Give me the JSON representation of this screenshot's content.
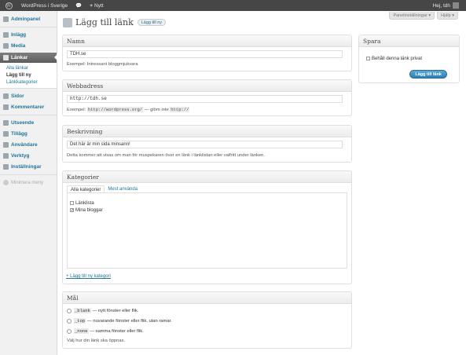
{
  "admin_bar": {
    "site_name": "WordPress i Sverige",
    "comments_count": "",
    "new_label": "Nytt",
    "greeting": "Hej, tdh"
  },
  "sidebar": {
    "items": [
      {
        "label": "Adminpanel",
        "icon": "dashboard-icon"
      },
      {
        "label": "Inlägg",
        "icon": "posts-icon"
      },
      {
        "label": "Media",
        "icon": "media-icon"
      },
      {
        "label": "Länkar",
        "icon": "links-icon"
      },
      {
        "label": "Sidor",
        "icon": "pages-icon"
      },
      {
        "label": "Kommentarer",
        "icon": "comments-icon"
      },
      {
        "label": "Utseende",
        "icon": "appearance-icon"
      },
      {
        "label": "Tillägg",
        "icon": "plugins-icon"
      },
      {
        "label": "Användare",
        "icon": "users-icon"
      },
      {
        "label": "Verktyg",
        "icon": "tools-icon"
      },
      {
        "label": "Inställningar",
        "icon": "settings-icon"
      }
    ],
    "submenu": [
      "Alla länkar",
      "Lägg till ny",
      "Länkkategorier"
    ],
    "collapse_label": "Minimera meny"
  },
  "screen_meta": {
    "screen_options": "Panelinställningar ▾",
    "help": "Hjälp ▾"
  },
  "page": {
    "title": "Lägg till länk",
    "add_new": "Lägg till ny"
  },
  "name_box": {
    "heading": "Namn",
    "value": "TDH.se",
    "example": "Exempel: Intressant bloggmjukvara"
  },
  "url_box": {
    "heading": "Webbadress",
    "value": "http://tdh.se",
    "example_prefix": "Exempel:",
    "example_code": "http://wordpress.org/",
    "example_mid": "— glöm inte",
    "example_code2": "http://"
  },
  "desc_box": {
    "heading": "Beskrivning",
    "value": "Det här är min sida minsann!",
    "note": "Detta kommer att visas om man för muspekaren över en länk i länklistan eller valfritt under länken."
  },
  "cat_box": {
    "heading": "Kategorier",
    "tab_all": "Alla kategorier",
    "tab_popular": "Mest använda",
    "categories": [
      {
        "label": "Länklista",
        "checked": false
      },
      {
        "label": "Mina bloggar",
        "checked": true
      }
    ],
    "add_link": "+ Lägg till ny kategori"
  },
  "target_box": {
    "heading": "Mål",
    "options": [
      {
        "code": "_blank",
        "desc": "— nytt fönster eller flik."
      },
      {
        "code": "_top",
        "desc": "— nuvarande fönster eller flik, utan ramar."
      },
      {
        "code": "_none",
        "desc": "— samma fönster eller flik."
      }
    ],
    "note": "Välj hur din länk ska öppnas."
  },
  "save_box": {
    "heading": "Spara",
    "private_label": "Behåll denna länk privat",
    "button": "Lägg till länk"
  },
  "colors": {
    "admin_bar": "#464646",
    "link": "#21759b",
    "primary_button": "#2b7fb6"
  }
}
